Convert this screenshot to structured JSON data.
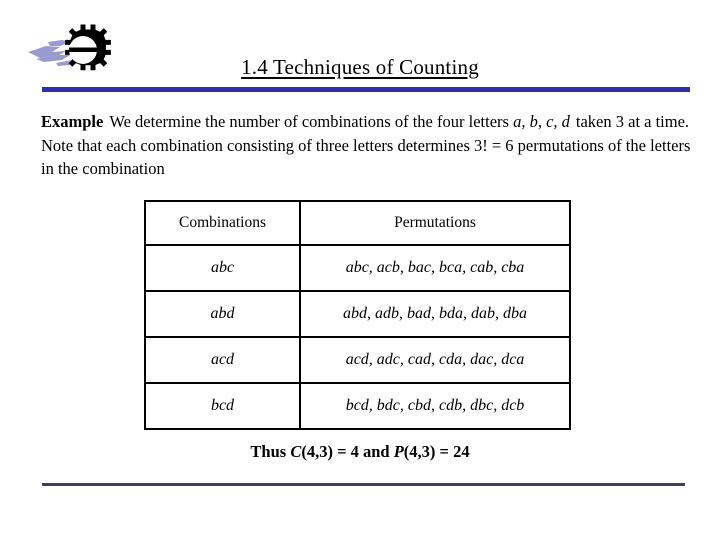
{
  "slide": {
    "title": "1.4 Techniques of Counting",
    "logo_icon": "gear-swoosh-logo-icon",
    "accent_color_top_rule": "#2e2eb0",
    "accent_color_bottom_rule": "#3e3e5f",
    "logo_gear_color": "#000000",
    "logo_swoosh_color": "#9a9ad0"
  },
  "body": {
    "label": "Example",
    "text_part1": "We determine the number of combinations of the four letters ",
    "letters_italic": "a, b, c, d",
    "letters_italic_line1": "a, b, c,",
    "letters_italic_line2": "d",
    "text_part2": "taken 3 at a time. Note that each combination consisting of three letters determines 3! = 6 permutations of the letters in the combination"
  },
  "table": {
    "headers": [
      "Combinations",
      "Permutations"
    ],
    "rows": [
      {
        "combination": "abc",
        "permutations": "abc, acb, bac, bca, cab, cba"
      },
      {
        "combination": "abd",
        "permutations": "abd, adb, bad, bda, dab, dba"
      },
      {
        "combination": "acd",
        "permutations": "acd, adc, cad, cda, dac, dca"
      },
      {
        "combination": "bcd",
        "permutations": "bcd, bdc, cbd, cdb, dbc, dcb"
      }
    ]
  },
  "conclusion": {
    "prefix": "Thus ",
    "c_symbol": "C",
    "c_args": "(4,3) = 4 and ",
    "p_symbol": "P",
    "p_args": "(4,3) = 24",
    "full_text": "Thus C(4,3) = 4 and P(4,3) = 24"
  }
}
